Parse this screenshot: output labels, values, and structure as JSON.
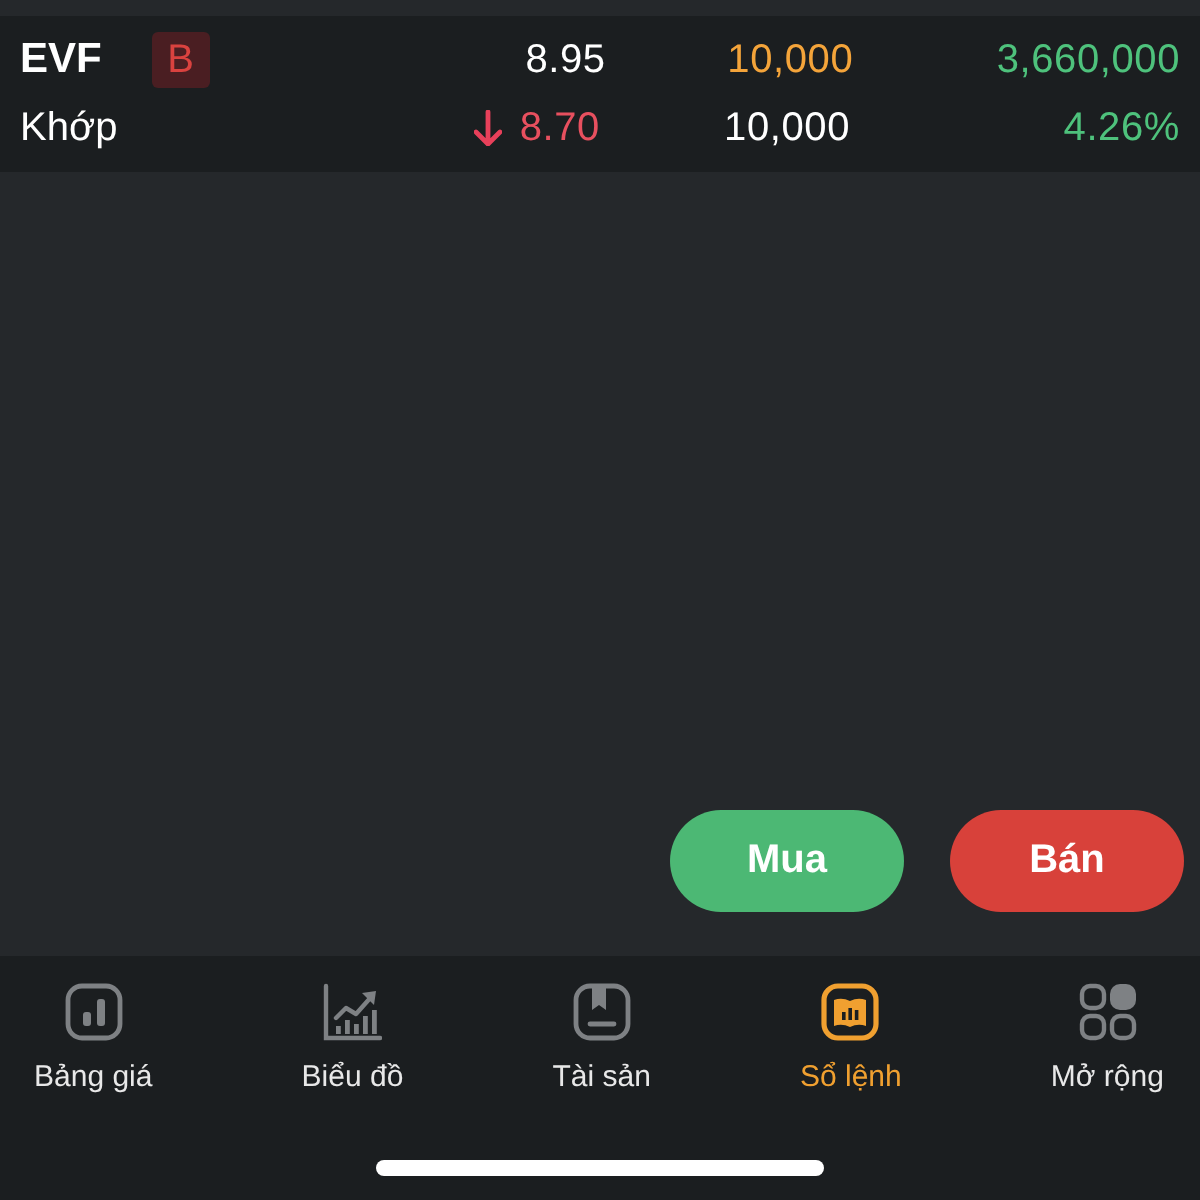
{
  "quote": {
    "rows": [
      {
        "symbol": "EVF",
        "badge": "B",
        "cells": [
          {
            "text": "8.95",
            "color": "#ffffff"
          },
          {
            "text": "10,000",
            "color": "#f4a43a"
          },
          {
            "text": "3,660,000",
            "color": "#4ec27c"
          }
        ]
      },
      {
        "label": "Khớp",
        "falling": true,
        "cells": [
          {
            "text": "8.70",
            "color": "#e8505f"
          },
          {
            "text": "10,000",
            "color": "#ffffff"
          },
          {
            "text": "4.26%",
            "color": "#4ec27c"
          }
        ]
      }
    ]
  },
  "actions": [
    {
      "label": "Mua",
      "kind": "buy"
    },
    {
      "label": "Bán",
      "kind": "sell"
    }
  ],
  "tab_bar": {
    "items": [
      {
        "label": "Bảng giá",
        "selected": false
      },
      {
        "label": "Biểu đồ",
        "selected": false
      },
      {
        "label": "Tài sản",
        "selected": false
      },
      {
        "label": "Sổ lệnh",
        "selected": true
      },
      {
        "label": "Mở rộng",
        "selected": false
      }
    ]
  }
}
